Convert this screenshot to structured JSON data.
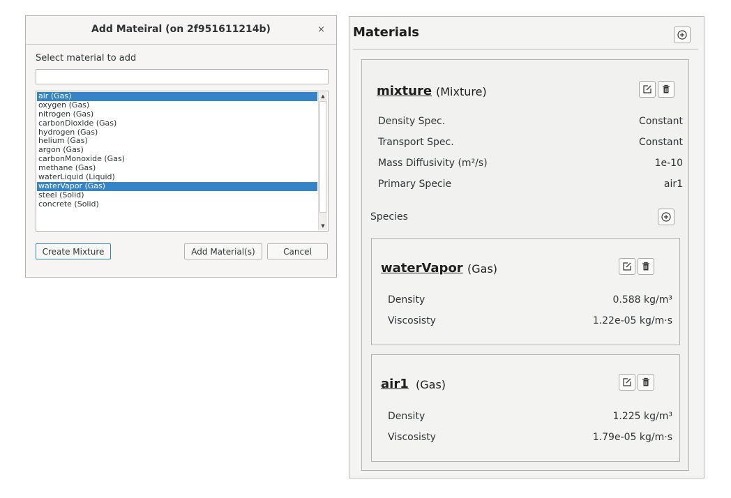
{
  "dialog": {
    "title": "Add Mateiral (on 2f951611214b)",
    "close_glyph": "×",
    "prompt": "Select material to add",
    "search": {
      "value": "",
      "placeholder": ""
    },
    "materials": [
      {
        "label": "air (Gas)",
        "selected": true
      },
      {
        "label": "oxygen (Gas)",
        "selected": false
      },
      {
        "label": "nitrogen (Gas)",
        "selected": false
      },
      {
        "label": "carbonDioxide (Gas)",
        "selected": false
      },
      {
        "label": "hydrogen (Gas)",
        "selected": false
      },
      {
        "label": "helium (Gas)",
        "selected": false
      },
      {
        "label": "argon (Gas)",
        "selected": false
      },
      {
        "label": "carbonMonoxide (Gas)",
        "selected": false
      },
      {
        "label": "methane (Gas)",
        "selected": false
      },
      {
        "label": "waterLiquid (Liquid)",
        "selected": false
      },
      {
        "label": "waterVapor (Gas)",
        "selected": true
      },
      {
        "label": "steel (Solid)",
        "selected": false
      },
      {
        "label": "concrete (Solid)",
        "selected": false
      }
    ],
    "scroll_up_glyph": "▲",
    "scroll_down_glyph": "▼",
    "buttons": {
      "create_mixture": "Create Mixture",
      "add_materials": "Add Material(s)",
      "cancel": "Cancel"
    }
  },
  "panel": {
    "title": "Materials",
    "mixture": {
      "name": "mixture",
      "kind": "(Mixture)",
      "properties": [
        {
          "label": "Density Spec.",
          "value": "Constant"
        },
        {
          "label": "Transport Spec.",
          "value": "Constant"
        },
        {
          "label": "Mass Diffusivity (m²/s)",
          "value": "1e-10"
        },
        {
          "label": "Primary Specie",
          "value": "air1"
        }
      ],
      "species_label": "Species",
      "species": [
        {
          "name": "waterVapor",
          "kind": "(Gas)",
          "properties": [
            {
              "label": "Density",
              "value": "0.588 kg/m³"
            },
            {
              "label": "Viscosisty",
              "value": "1.22e-05 kg/m·s"
            }
          ]
        },
        {
          "name": "air1",
          "kind": "(Gas)",
          "properties": [
            {
              "label": "Density",
              "value": "1.225 kg/m³"
            },
            {
              "label": "Viscosisty",
              "value": "1.79e-05 kg/m·s"
            }
          ]
        }
      ]
    }
  },
  "icons": {
    "add": "plus-circle-icon",
    "edit": "edit-icon",
    "delete": "trash-icon"
  },
  "colors": {
    "selection": "#3584c8",
    "focus_border": "#3584c8"
  }
}
